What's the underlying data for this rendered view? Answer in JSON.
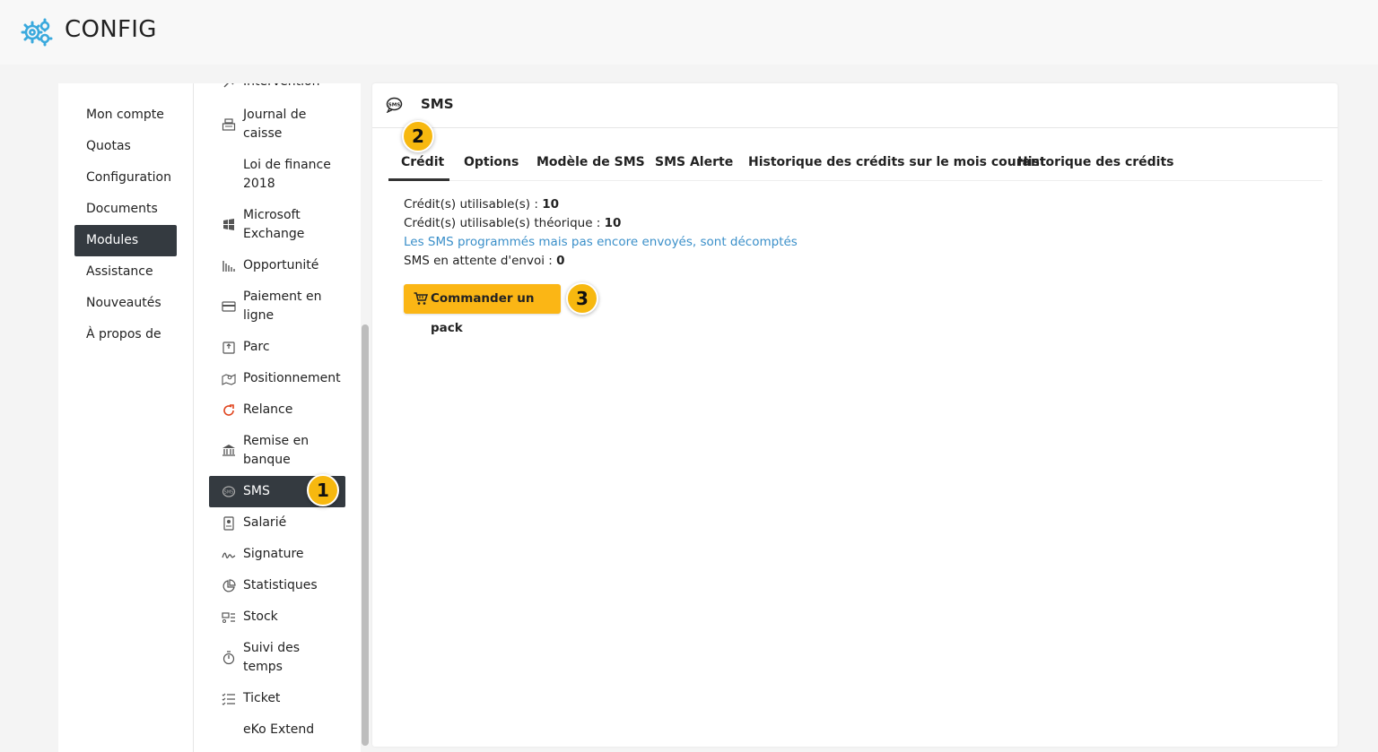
{
  "header": {
    "title": "CONFIG",
    "icon": "gear-icon",
    "accent": "#3aa9dd"
  },
  "left_menu": {
    "items": [
      {
        "label": "Mon compte",
        "active": false
      },
      {
        "label": "Quotas",
        "active": false
      },
      {
        "label": "Configuration",
        "active": false
      },
      {
        "label": "Documents",
        "active": false
      },
      {
        "label": "Modules",
        "active": true
      },
      {
        "label": "Assistance",
        "active": false
      },
      {
        "label": "Nouveautés",
        "active": false
      },
      {
        "label": "À propos de",
        "active": false
      }
    ]
  },
  "modules_menu": {
    "items": [
      {
        "label": "Intervention",
        "icon": "tools-icon"
      },
      {
        "label": "Journal de caisse",
        "icon": "cash-register-icon"
      },
      {
        "label": "Loi de finance 2018",
        "icon": ""
      },
      {
        "label": "Microsoft Exchange",
        "icon": "windows-icon"
      },
      {
        "label": "Opportunité",
        "icon": "bar-chart-icon"
      },
      {
        "label": "Paiement en ligne",
        "icon": "credit-card-icon"
      },
      {
        "label": "Parc",
        "icon": "box-icon"
      },
      {
        "label": "Positionnement",
        "icon": "map-icon"
      },
      {
        "label": "Relance",
        "icon": "refresh-icon"
      },
      {
        "label": "Remise en banque",
        "icon": "bank-icon"
      },
      {
        "label": "SMS",
        "icon": "sms-icon",
        "active": true
      },
      {
        "label": "Salarié",
        "icon": "id-badge-icon"
      },
      {
        "label": "Signature",
        "icon": "signature-icon"
      },
      {
        "label": "Statistiques",
        "icon": "pie-chart-icon"
      },
      {
        "label": "Stock",
        "icon": "stock-icon"
      },
      {
        "label": "Suivi des temps",
        "icon": "stopwatch-icon"
      },
      {
        "label": "Ticket",
        "icon": "checklist-icon"
      },
      {
        "label": "eKo Extend",
        "icon": ""
      }
    ]
  },
  "main": {
    "title": "SMS",
    "tabs": [
      {
        "label": "Crédit",
        "active": true
      },
      {
        "label": "Options"
      },
      {
        "label": "Modèle de SMS"
      },
      {
        "label": "SMS Alerte"
      },
      {
        "label": "Historique des crédits sur le mois courant"
      },
      {
        "label": "Historique des crédits"
      }
    ],
    "credit": {
      "usable_label": "Crédit(s) utilisable(s) :",
      "usable_value": "10",
      "theoretical_label": "Crédit(s) utilisable(s) théorique :",
      "theoretical_value": "10",
      "note": "Les SMS programmés mais pas encore envoyés, sont décomptés",
      "pending_label": "SMS en attente d'envoi :",
      "pending_value": "0",
      "order_button": "Commander un pack"
    }
  },
  "badges": [
    "1",
    "2",
    "3"
  ],
  "colors": {
    "active_bg": "#343a40",
    "button": "#fbb615",
    "badge": "#f7b80f",
    "link": "#3a8fc9"
  }
}
